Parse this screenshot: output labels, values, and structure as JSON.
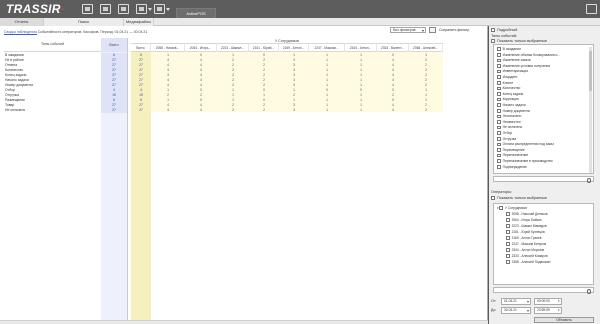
{
  "app": {
    "logo": "TRASSIR",
    "window_tab": "ActivePOS"
  },
  "colors": {
    "accent_blue": "#3a49a3",
    "total_col": "#dfe3f7",
    "highlight": "#fffbe0",
    "logo_dot": "#e23b2e"
  },
  "icons": [
    "layout-icon",
    "video-icon",
    "archive-icon",
    "grid-icon",
    "menu-icon",
    "window-icon"
  ],
  "tabs": [
    "Отчеты",
    "Поиск",
    "Медиафайлы"
  ],
  "main": {
    "info_link": "Сводка наблюдения",
    "info_text": "Событийность операторов. Кассиров. Период: 01.04.21 — 30.04.21",
    "filter": "Без фильтров",
    "save_label": "Сохранить фильтр"
  },
  "left_table": {
    "col_type": "Типы событий",
    "col_total": "Всего",
    "rows": [
      {
        "name": "В ожидании",
        "total": "6"
      },
      {
        "name": "Не в работе",
        "total": "27"
      },
      {
        "name": "Отмена",
        "total": "27"
      },
      {
        "name": "Количество",
        "total": "27"
      },
      {
        "name": "Конец задачи",
        "total": "27"
      },
      {
        "name": "Начало задачи",
        "total": "27"
      },
      {
        "name": "Номер документа",
        "total": "27"
      },
      {
        "name": "Отбор",
        "total": "4"
      },
      {
        "name": "Отгрузка",
        "total": "15"
      },
      {
        "name": "Размещение",
        "total": "6"
      },
      {
        "name": "Товар",
        "total": "27"
      },
      {
        "name": "Не оплачено",
        "total": "27"
      }
    ]
  },
  "grid": {
    "title": "У Сотрудников",
    "headers": [
      "Всего",
      "2058 - Ниязов...",
      "2064 - Игорь...",
      "2223 - Шамил...",
      "2161 - Юрий...",
      "2169 - Антон...",
      "2247 - Максим...",
      "2344 - Антон...",
      "2333 - Валент...",
      "2368 - Алексей..."
    ],
    "rows": [
      [
        "6",
        "1",
        "0",
        "1",
        "0",
        "1",
        "1",
        "1",
        "0",
        "1"
      ],
      [
        "27",
        "4",
        "4",
        "2",
        "2",
        "3",
        "1",
        "1",
        "4",
        "2"
      ],
      [
        "27",
        "4",
        "4",
        "2",
        "2",
        "3",
        "1",
        "1",
        "4",
        "2"
      ],
      [
        "27",
        "4",
        "4",
        "2",
        "2",
        "3",
        "1",
        "1",
        "4",
        "2"
      ],
      [
        "27",
        "4",
        "4",
        "2",
        "2",
        "3",
        "1",
        "1",
        "4",
        "2"
      ],
      [
        "27",
        "4",
        "4",
        "2",
        "2",
        "3",
        "1",
        "1",
        "4",
        "2"
      ],
      [
        "27",
        "4",
        "4",
        "2",
        "2",
        "3",
        "1",
        "1",
        "4",
        "2"
      ],
      [
        "4",
        "1",
        "0",
        "1",
        "0",
        "1",
        "0",
        "0",
        "0",
        "1"
      ],
      [
        "15",
        "2",
        "2",
        "1",
        "1",
        "2",
        "1",
        "1",
        "2",
        "1"
      ],
      [
        "6",
        "1",
        "0",
        "1",
        "0",
        "1",
        "1",
        "1",
        "0",
        "1"
      ],
      [
        "27",
        "4",
        "4",
        "2",
        "2",
        "3",
        "1",
        "1",
        "4",
        "2"
      ],
      [
        "27",
        "4",
        "4",
        "2",
        "2",
        "3",
        "1",
        "1",
        "4",
        "2"
      ]
    ]
  },
  "side": {
    "detailed_label": "Подробный",
    "event_types_label": "Типы событий:",
    "show_selected_label": "Показать только выбранные",
    "events": [
      "В ожидании",
      "Изменение объема блокирования и...",
      "Изменение заказа",
      "Изменение условия получения",
      "Инвентаризация",
      "Инцидент",
      "Клиент",
      "Количество",
      "Конец задачи",
      "Коррекция",
      "Начало задачи",
      "Номер документа",
      "Неоплачено",
      "Неизвестно",
      "Не оплачено",
      "Отбор",
      "Отгрузка",
      "Оплата распределения под заказ",
      "Перемещение",
      "Переназначение",
      "Переназначение в производство",
      "Подтверждение"
    ],
    "operators_label": "Операторы:",
    "operators_show_selected": "Показать только выбранные",
    "operator_group": "У Сотрудников",
    "operators": [
      "2058 - Николай Денисов",
      "2064 - Игорь Бабкин",
      "2223 - Шамил Мамедов",
      "2161 - Юрий Кузнецов",
      "2169 - Антон Грачев",
      "2247 - Максим Белусов",
      "2344 - Антон Морозов",
      "2333 - Алексей Комаров",
      "2368 - Алексей Подвозкин"
    ],
    "from_label": "От:",
    "from_date": "01.04.21",
    "from_time": "00:00:00",
    "to_label": "До:",
    "to_date": "30.04.21",
    "to_time": "23:59:59",
    "apply_label": "Обновить"
  }
}
